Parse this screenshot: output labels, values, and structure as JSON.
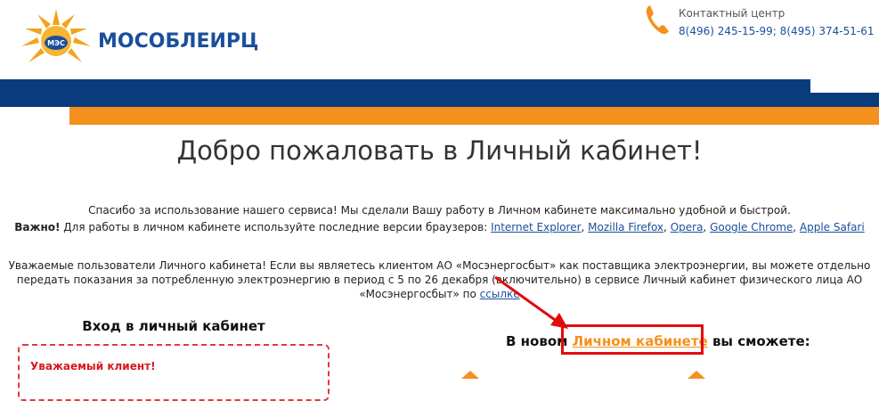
{
  "header": {
    "logo_text": "МОСОБЛЕИРЦ",
    "logo_badge": "МЭС",
    "contact_title": "Контактный центр",
    "contact_phones": "8(496) 245-15-99; 8(495) 374-51-61"
  },
  "main": {
    "welcome": "Добро пожаловать в Личный кабинет!",
    "thanks": "Спасибо за использование нашего сервиса! Мы сделали Вашу работу в Личном кабинете максимально удобной и быстрой.",
    "important_label": "Важно!",
    "important_text": " Для работы в личном кабинете используйте последние версии браузеров: ",
    "browsers": [
      "Internet Explorer",
      "Mozilla Firefox",
      "Opera",
      "Google Chrome",
      "Apple Safari"
    ],
    "notice_text": "Уважаемые пользователи Личного кабинета! Если вы являетесь клиентом АО «Мосэнергосбыт» как поставщика электроэнергии, вы можете отдельно передать показания за потребленную электроэнергию в период с 5 по 26 декабря (включительно) в сервисе Личный кабинет физического лица АО «Мосэнергосбыт» по ",
    "notice_link": "ссылке",
    "login_title": "Вход в личный кабинет",
    "login_warning": "Уважаемый клиент!",
    "newcab_prefix": "В новом ",
    "newcab_link": "Личном кабинете",
    "newcab_suffix": " вы сможете:"
  },
  "colors": {
    "brand_blue": "#0a3c7d",
    "brand_orange": "#f4901e",
    "link_blue": "#1a4f9c",
    "alert_red": "#e10c0c"
  }
}
